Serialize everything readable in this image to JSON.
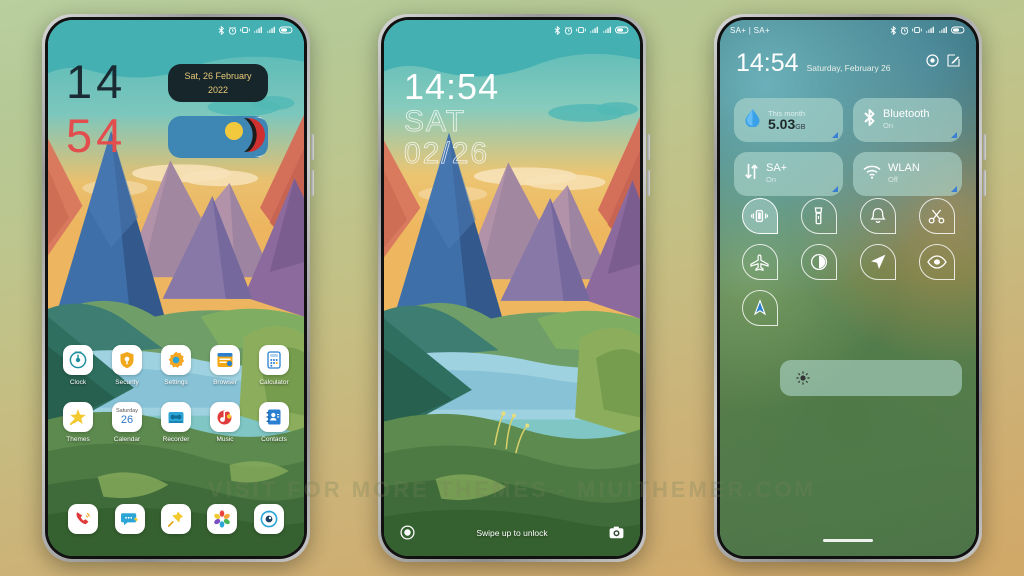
{
  "watermark": "VISIT FOR MORE THEMES - MIUITHEMER.COM",
  "status_bar": {
    "carrier_home": "",
    "carrier_control": "SA+ | SA+",
    "icons": [
      "bluetooth-icon",
      "alarm-icon",
      "vibrate-icon",
      "signal-icon-1",
      "signal-icon-2",
      "battery-icon"
    ]
  },
  "home_screen": {
    "clock_hours": "14",
    "clock_minutes": "54",
    "date_line1": "Sat, 26 February",
    "date_line2": "2022",
    "apps_row1": [
      {
        "label": "Clock",
        "icon": "clock-icon"
      },
      {
        "label": "Security",
        "icon": "shield-icon"
      },
      {
        "label": "Settings",
        "icon": "gear-icon"
      },
      {
        "label": "Browser",
        "icon": "browser-icon"
      },
      {
        "label": "Calculator",
        "icon": "calculator-icon"
      }
    ],
    "apps_row2": [
      {
        "label": "Themes",
        "icon": "magic-wand-icon"
      },
      {
        "label": "Calendar",
        "icon": "calendar-icon",
        "day": "Saturday",
        "date": "26"
      },
      {
        "label": "Recorder",
        "icon": "recorder-icon"
      },
      {
        "label": "Music",
        "icon": "music-icon"
      },
      {
        "label": "Contacts",
        "icon": "contacts-icon"
      }
    ],
    "dock": [
      {
        "label": "Phone",
        "icon": "phone-icon"
      },
      {
        "label": "Messages",
        "icon": "message-icon"
      },
      {
        "label": "Notes",
        "icon": "pin-icon"
      },
      {
        "label": "Gallery",
        "icon": "flower-icon"
      },
      {
        "label": "Camera",
        "icon": "camera-lens-icon"
      }
    ]
  },
  "lock_screen": {
    "time": "14:54",
    "day_of_week": "SAT",
    "date": "02/26",
    "unlock_hint": "Swipe up to unlock",
    "left_icon": "fingerprint-icon",
    "right_icon": "camera-icon"
  },
  "control_center": {
    "time": "14:54",
    "date": "Saturday, February 26",
    "settings_icon": "settings-icon",
    "edit_icon": "edit-icon",
    "tiles": [
      {
        "top": "This month",
        "main": "5.03",
        "unit": "GB",
        "icon": "data-drop-icon",
        "style": "data"
      },
      {
        "main": "Bluetooth",
        "sub": "On",
        "icon": "bluetooth-icon",
        "style": "normal"
      },
      {
        "main": "SA+",
        "sub": "On",
        "icon": "data-arrows-icon",
        "style": "normal"
      },
      {
        "main": "WLAN",
        "sub": "Off",
        "icon": "wifi-icon",
        "style": "normal"
      }
    ],
    "toggles": [
      {
        "name": "vibrate-toggle",
        "icon": "vibrate-icon",
        "active": true
      },
      {
        "name": "flashlight-toggle",
        "icon": "flashlight-icon",
        "active": false
      },
      {
        "name": "ringer-toggle",
        "icon": "bell-icon",
        "active": false
      },
      {
        "name": "screenshot-toggle",
        "icon": "scissors-icon",
        "active": false
      },
      {
        "name": "airplane-toggle",
        "icon": "airplane-icon",
        "active": false
      },
      {
        "name": "darkmode-toggle",
        "icon": "contrast-icon",
        "active": false
      },
      {
        "name": "location-toggle",
        "icon": "location-arrow-icon",
        "active": false
      },
      {
        "name": "eyecare-toggle",
        "icon": "eye-icon",
        "active": false
      },
      {
        "name": "autorotate-toggle",
        "icon": "rotate-arrow-icon",
        "active": false
      }
    ],
    "brightness_icon": "brightness-icon"
  },
  "colors": {
    "accent_red": "#e24d4d",
    "clock_dark": "#1b2b33",
    "date_card_bg": "#17262b",
    "date_card_text": "#e8c877",
    "weather_card_bg": "#3e87b5",
    "tile_bg": "rgba(175,215,205,0.62)"
  }
}
